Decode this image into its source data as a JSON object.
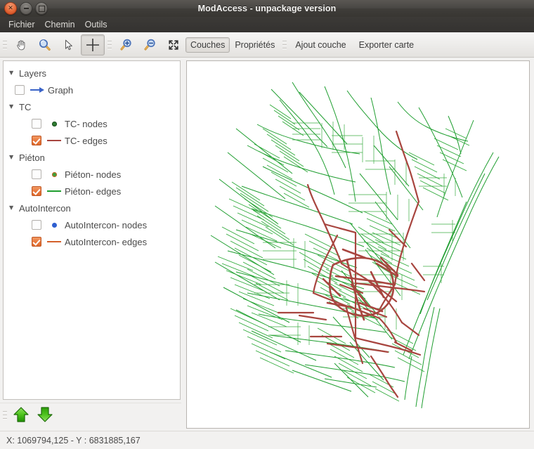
{
  "window": {
    "title": "ModAccess - unpackage version",
    "buttons": [
      {
        "name": "close",
        "glyph": "✕"
      },
      {
        "name": "minimize",
        "glyph": "–"
      },
      {
        "name": "maximize",
        "glyph": "□"
      }
    ]
  },
  "menubar": {
    "items": [
      {
        "label": "Fichier"
      },
      {
        "label": "Chemin"
      },
      {
        "label": "Outils"
      }
    ]
  },
  "toolbar": {
    "tools": [
      {
        "icon": "pan-hand-icon",
        "active": false
      },
      {
        "icon": "zoom-select-icon",
        "active": false
      },
      {
        "icon": "cursor-arrow-icon",
        "active": false
      },
      {
        "icon": "crosshair-icon",
        "active": true
      },
      {
        "icon": "zoom-in-icon",
        "active": false
      },
      {
        "icon": "zoom-out-icon",
        "active": false
      },
      {
        "icon": "fit-extent-icon",
        "active": false
      }
    ],
    "labels": [
      {
        "text": "Couches",
        "pressed": true
      },
      {
        "text": "Propriétés",
        "pressed": false
      },
      {
        "text": "Ajout couche",
        "pressed": false
      },
      {
        "text": "Exporter carte",
        "pressed": false
      }
    ]
  },
  "tree": {
    "nodes": [
      {
        "label": "Layers",
        "level": 0,
        "expander": "▼",
        "checkbox": null,
        "swatch": null
      },
      {
        "label": "Graph",
        "level": 1,
        "expander": null,
        "checkbox": "off",
        "swatch": "arrow",
        "color": "#3a63c8"
      },
      {
        "label": "TC",
        "level": 0,
        "expander": "▼",
        "checkbox": null,
        "swatch": null
      },
      {
        "label": "TC- nodes",
        "level": 2,
        "expander": null,
        "checkbox": "off",
        "swatch": "dot",
        "color": "#2f7d32"
      },
      {
        "label": "TC- edges",
        "level": 2,
        "expander": null,
        "checkbox": "on",
        "swatch": "line",
        "color": "#a8453f"
      },
      {
        "label": "Piéton",
        "level": 0,
        "expander": "▼",
        "checkbox": null,
        "swatch": null
      },
      {
        "label": "Piéton- nodes",
        "level": 2,
        "expander": null,
        "checkbox": "off",
        "swatch": "dot",
        "color": "#3ca33c"
      },
      {
        "label": "Piéton- edges",
        "level": 2,
        "expander": null,
        "checkbox": "on",
        "swatch": "line",
        "color": "#1f9e30"
      },
      {
        "label": "AutoIntercon",
        "level": 0,
        "expander": "▼",
        "checkbox": null,
        "swatch": null
      },
      {
        "label": "AutoIntercon- nodes",
        "level": 2,
        "expander": null,
        "checkbox": "off",
        "swatch": "dot",
        "color": "#2e5fd0"
      },
      {
        "label": "AutoIntercon- edges",
        "level": 2,
        "expander": null,
        "checkbox": "on",
        "swatch": "line",
        "color": "#d4602a"
      }
    ]
  },
  "navigation": {
    "up_label": "move-layer-up",
    "down_label": "move-layer-down",
    "arrow_color": "#2fa720"
  },
  "statusbar": {
    "coordinates": "X: 1069794,125 - Y : 6831885,167"
  },
  "map": {
    "pedestrian_color": "#1f9e30",
    "transit_color": "#a8453f",
    "background": "#ffffff"
  }
}
